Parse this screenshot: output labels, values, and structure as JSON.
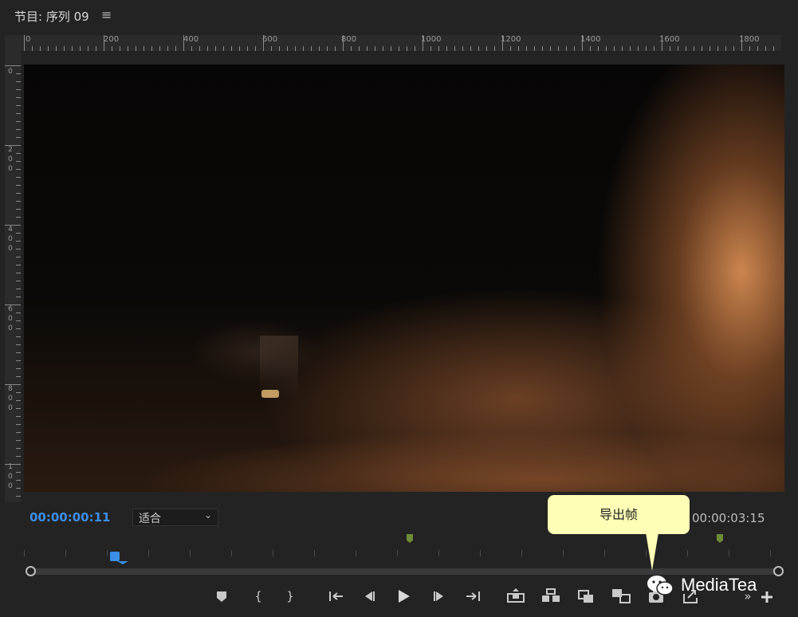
{
  "panel": {
    "title": "节目: 序列 09",
    "menu_icon": "hamburger-menu-icon"
  },
  "ruler": {
    "horizontal_labels": [
      "0",
      "200",
      "400",
      "600",
      "800",
      "1000",
      "1200",
      "1400",
      "1600",
      "1800"
    ],
    "vertical_labels": [
      "0",
      "2\n0\n0",
      "4\n0\n0",
      "6\n0\n0",
      "8\n0\n0",
      "1\n0\n0"
    ]
  },
  "playback": {
    "current_timecode": "00:00:00:11",
    "fit_value": "适合",
    "duration_timecode": "00:00:03:15"
  },
  "tooltip": {
    "label": "导出帧"
  },
  "transport": {
    "buttons": [
      {
        "name": "add-marker-button",
        "icon": "marker-icon",
        "glyph": "⯃"
      },
      {
        "name": "mark-in-button",
        "icon": "mark-in-icon",
        "glyph": "{"
      },
      {
        "name": "mark-out-button",
        "icon": "mark-out-icon",
        "glyph": "}"
      },
      {
        "name": "go-to-in-button",
        "icon": "go-to-in-icon",
        "glyph": "{←"
      },
      {
        "name": "step-back-button",
        "icon": "step-back-icon",
        "glyph": "◀|"
      },
      {
        "name": "play-button",
        "icon": "play-icon",
        "glyph": "▶"
      },
      {
        "name": "step-forward-button",
        "icon": "step-forward-icon",
        "glyph": "|▶"
      },
      {
        "name": "go-to-out-button",
        "icon": "go-to-out-icon",
        "glyph": "→}"
      },
      {
        "name": "lift-button",
        "icon": "lift-icon",
        "glyph": "⬆"
      },
      {
        "name": "extract-button",
        "icon": "extract-icon",
        "glyph": "⇲"
      },
      {
        "name": "toggle-proxies-button",
        "icon": "proxy-icon",
        "glyph": "⟲"
      },
      {
        "name": "comparison-view-button",
        "icon": "comparison-icon",
        "glyph": "▣"
      },
      {
        "name": "export-frame-button",
        "icon": "camera-icon",
        "glyph": "📷"
      },
      {
        "name": "export-button",
        "icon": "share-icon",
        "glyph": "⇪"
      },
      {
        "name": "more-button",
        "icon": "chevron-double-right-icon",
        "glyph": "»"
      },
      {
        "name": "add-button",
        "icon": "plus-icon",
        "glyph": "+"
      }
    ]
  },
  "watermark": {
    "text": "MediaTea",
    "icon": "wechat-icon"
  },
  "colors": {
    "accent": "#3c8ee8",
    "marker": "#6f8b36",
    "tooltip_bg": "#fefeb6"
  }
}
